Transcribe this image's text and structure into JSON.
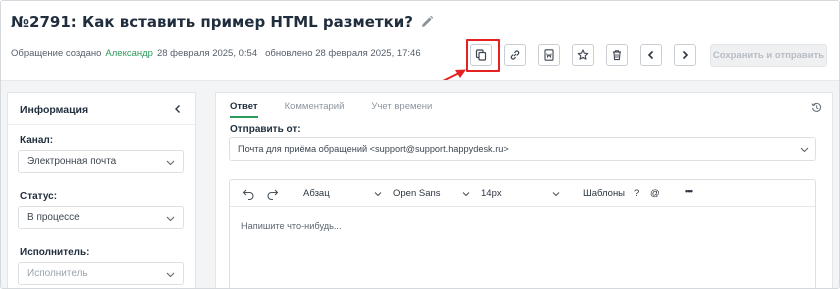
{
  "ticket": {
    "title": "№2791:  Как вставить пример HTML разметки?",
    "meta": {
      "created_prefix": "Обращение создано",
      "author": "Александр",
      "created_date": "28 февраля 2025, 0:54",
      "updated_text": "обновлено 28 февраля 2025, 17:46"
    }
  },
  "toolbar": {
    "buttons": [
      "copy-icon",
      "link-icon",
      "word-document-icon",
      "star-icon",
      "trash-icon",
      "chevron-left-icon",
      "chevron-right-icon"
    ],
    "submit_label": "Сохранить и отправить"
  },
  "info_panel": {
    "header": "Информация",
    "fields": {
      "channel": {
        "label": "Канал:",
        "value": "Электронная почта"
      },
      "status": {
        "label": "Статус:",
        "value": "В процессе"
      },
      "assignee": {
        "label": "Исполнитель:",
        "placeholder": "Исполнитель"
      }
    }
  },
  "reply_panel": {
    "tabs": [
      "Ответ",
      "Комментарий",
      "Учет времени"
    ],
    "active_tab": "Ответ",
    "send_from_label": "Отправить от:",
    "send_from_value": "Почта для приёма обращений <support@support.happydesk.ru>",
    "editor": {
      "paragraph": "Абзац",
      "font": "Open Sans",
      "size": "14px",
      "templates": "Шаблоны",
      "help": "?",
      "mention": "@",
      "more": "•••",
      "placeholder": "Напишите что-нибудь..."
    }
  },
  "colors": {
    "accent_green": "#2c9a5b",
    "highlight_red": "#e52222",
    "disabled_button_bg": "#eef0f2"
  }
}
